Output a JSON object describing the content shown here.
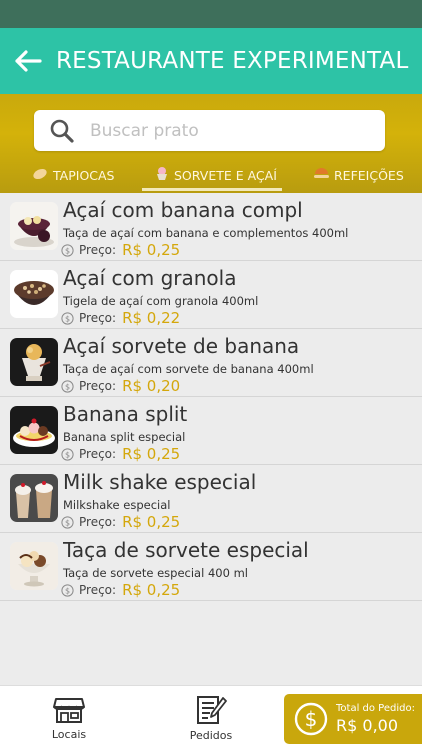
{
  "header": {
    "title": "RESTAURANTE EXPERIMENTAL"
  },
  "search": {
    "placeholder": "Buscar prato",
    "value": ""
  },
  "tabs": [
    {
      "label": "TAPIOCAS",
      "icon": "tapioca-icon",
      "active": false
    },
    {
      "label": "SORVETE E AÇAÍ",
      "icon": "ice-cream-icon",
      "active": true
    },
    {
      "label": "REFEIÇÕES",
      "icon": "meal-icon",
      "active": false
    }
  ],
  "items": [
    {
      "name": "Açaí com banana compl",
      "desc": "Taça de açaí com banana e complementos 400ml",
      "price_label": "Preço:",
      "price": "R$ 0,25",
      "image": "acai-banana-photo"
    },
    {
      "name": "Açaí com granola",
      "desc": "Tigela de açaí com granola 400ml",
      "price_label": "Preço:",
      "price": "R$ 0,22",
      "image": "acai-granola-photo"
    },
    {
      "name": "Açaí sorvete de banana",
      "desc": "Taça de açaí com sorvete de banana 400ml",
      "price_label": "Preço:",
      "price": "R$ 0,20",
      "image": "acai-sorvete-photo"
    },
    {
      "name": "Banana split",
      "desc": "Banana split especial",
      "price_label": "Preço:",
      "price": "R$ 0,25",
      "image": "banana-split-photo"
    },
    {
      "name": "Milk shake especial",
      "desc": "Milkshake especial",
      "price_label": "Preço:",
      "price": "R$ 0,25",
      "image": "milkshake-photo"
    },
    {
      "name": "Taça de sorvete especial",
      "desc": "Taça de sorvete especial 400 ml",
      "price_label": "Preço:",
      "price": "R$ 0,25",
      "image": "sundae-photo"
    }
  ],
  "bottom_nav": {
    "locais": "Locais",
    "pedidos": "Pedidos",
    "total_label": "Total do Pedido:",
    "total_value": "R$ 0,00"
  },
  "colors": {
    "header": "#2dc3a6",
    "accent": "#c9a70c",
    "price": "#d4a70b",
    "status_bar": "#3e6f5b"
  }
}
